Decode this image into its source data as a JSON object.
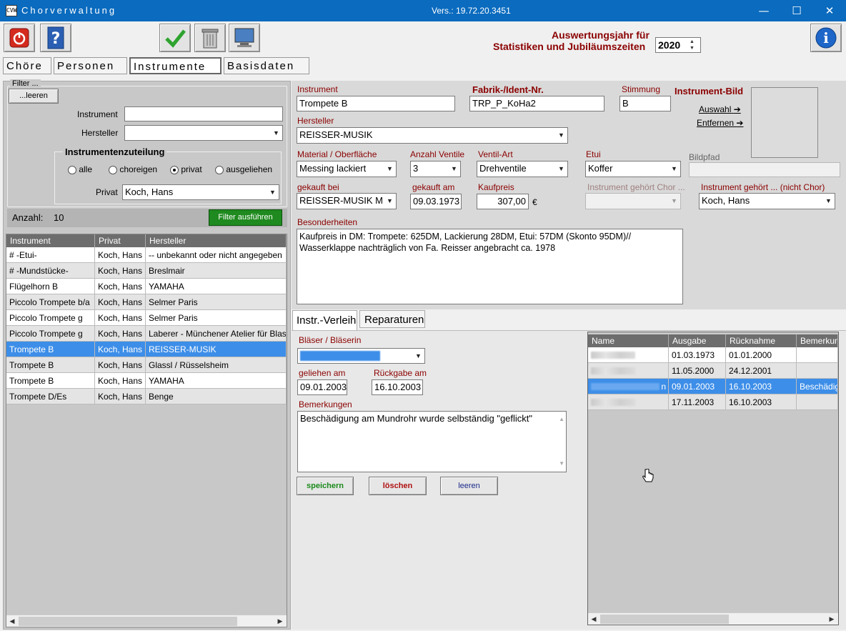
{
  "window": {
    "title": "Chorverwaltung",
    "version": "Vers.: 19.72.20.3451",
    "controls": {
      "minimize": "—",
      "maximize": "☐",
      "close": "✕"
    },
    "icon_text": "CVW"
  },
  "toolbar": {
    "year_label_line1": "Auswertungsjahr für",
    "year_label_line2": "Statistiken und Jubiläumszeiten",
    "year_value": "2020",
    "icons": [
      "power-icon",
      "help-icon",
      "checkmark-icon",
      "trash-icon",
      "monitor-icon",
      "info-icon"
    ]
  },
  "tabs": [
    "Chöre",
    "Personen",
    "Instrumente",
    "Basisdaten"
  ],
  "filter": {
    "group_title": "Filter ...",
    "clear_button": "...leeren",
    "instrument_label": "Instrument",
    "instrument_value": "",
    "manufacturer_label": "Hersteller",
    "manufacturer_value": "",
    "assignment_title": "Instrumentenzuteilung",
    "radio_options": [
      "alle",
      "choreigen",
      "privat",
      "ausgeliehen"
    ],
    "radio_selected": "privat",
    "private_label": "Privat",
    "private_value": "Koch, Hans",
    "count_label": "Anzahl:",
    "count_value": "10",
    "run_button": "Filter ausführen"
  },
  "instrument_list": {
    "columns": [
      "Instrument",
      "Privat",
      "Hersteller"
    ],
    "rows": [
      [
        "# -Etui-",
        "Koch, Hans",
        "-- unbekannt oder nicht angegeben"
      ],
      [
        "# -Mundstücke-",
        "Koch, Hans",
        "Breslmair"
      ],
      [
        "Flügelhorn B",
        "Koch, Hans",
        "YAMAHA"
      ],
      [
        "Piccolo Trompete b/a",
        "Koch, Hans",
        "Selmer Paris"
      ],
      [
        "Piccolo Trompete g",
        "Koch, Hans",
        "Selmer Paris"
      ],
      [
        "Piccolo Trompete g",
        "Koch, Hans",
        "Laberer - Münchener Atelier für Blas"
      ],
      [
        "Trompete B",
        "Koch, Hans",
        "REISSER-MUSIK"
      ],
      [
        "Trompete B",
        "Koch, Hans",
        "Glassl / Rüsselsheim"
      ],
      [
        "Trompete B",
        "Koch, Hans",
        "YAMAHA"
      ],
      [
        "Trompete D/Es",
        "Koch, Hans",
        "Benge"
      ]
    ],
    "selected_index": 6
  },
  "detail": {
    "instrument_label": "Instrument",
    "instrument_value": "Trompete B",
    "ident_label": "Fabrik-/Ident-Nr.",
    "ident_value": "TRP_P_KoHa2",
    "tuning_label": "Stimmung",
    "tuning_value": "B",
    "image_label": "Instrument-Bild",
    "image_select": "Auswahl",
    "image_remove": "Entfernen",
    "manufacturer_label": "Hersteller",
    "manufacturer_value": "REISSER-MUSIK",
    "material_label": "Material / Oberfläche",
    "material_value": "Messing lackiert",
    "valves_label": "Anzahl Ventile",
    "valves_value": "3",
    "valve_type_label": "Ventil-Art",
    "valve_type_value": "Drehventile",
    "case_label": "Etui",
    "case_value": "Koffer",
    "image_path_label": "Bildpfad",
    "image_path_value": "",
    "bought_at_label": "gekauft bei",
    "bought_at_value": "REISSER-MUSIK M",
    "bought_on_label": "gekauft am",
    "bought_on_value": "09.03.1973",
    "price_label": "Kaufpreis",
    "price_value": "307,00",
    "currency": "€",
    "choir_owner_label": "Instrument gehört Chor ...",
    "choir_owner_value": "",
    "owner_label": "Instrument gehört ... (nicht Chor)",
    "owner_value": "Koch, Hans",
    "notes_label": "Besonderheiten",
    "notes_value": "Kaufpreis in DM: Trompete: 625DM, Lackierung 28DM, Etui: 57DM (Skonto 95DM)//\nWasserklappe nachträglich von Fa. Reisser angebracht ca. 1978"
  },
  "subtabs": [
    "Instr.-Verleih",
    "Reparaturen"
  ],
  "loan": {
    "player_label": "Bläser / Bläserin",
    "lent_label": "geliehen am",
    "lent_value": "09.01.2003",
    "return_label": "Rückgabe am",
    "return_value": "16.10.2003",
    "remarks_label": "Bemerkungen",
    "remarks_value": "Beschädigung am Mundrohr wurde selbständig \"geflickt\"",
    "save_button": "speichern",
    "delete_button": "löschen",
    "clear_button": "leeren",
    "columns": [
      "Name",
      "Ausgabe",
      "Rücknahme",
      "Bemerkun"
    ],
    "rows": [
      [
        "",
        "01.03.1973",
        "01.01.2000",
        ""
      ],
      [
        "",
        "11.05.2000",
        "24.12.2001",
        ""
      ],
      [
        "n",
        "09.01.2003",
        "16.10.2003",
        "Beschädig"
      ],
      [
        "",
        "17.11.2003",
        "16.10.2003",
        ""
      ]
    ],
    "selected_index": 2
  },
  "colors": {
    "titlebar": "#0a6bbf",
    "selection": "#3d8ee8",
    "label_red": "#8b0000",
    "run_button": "#1f8a1f"
  }
}
